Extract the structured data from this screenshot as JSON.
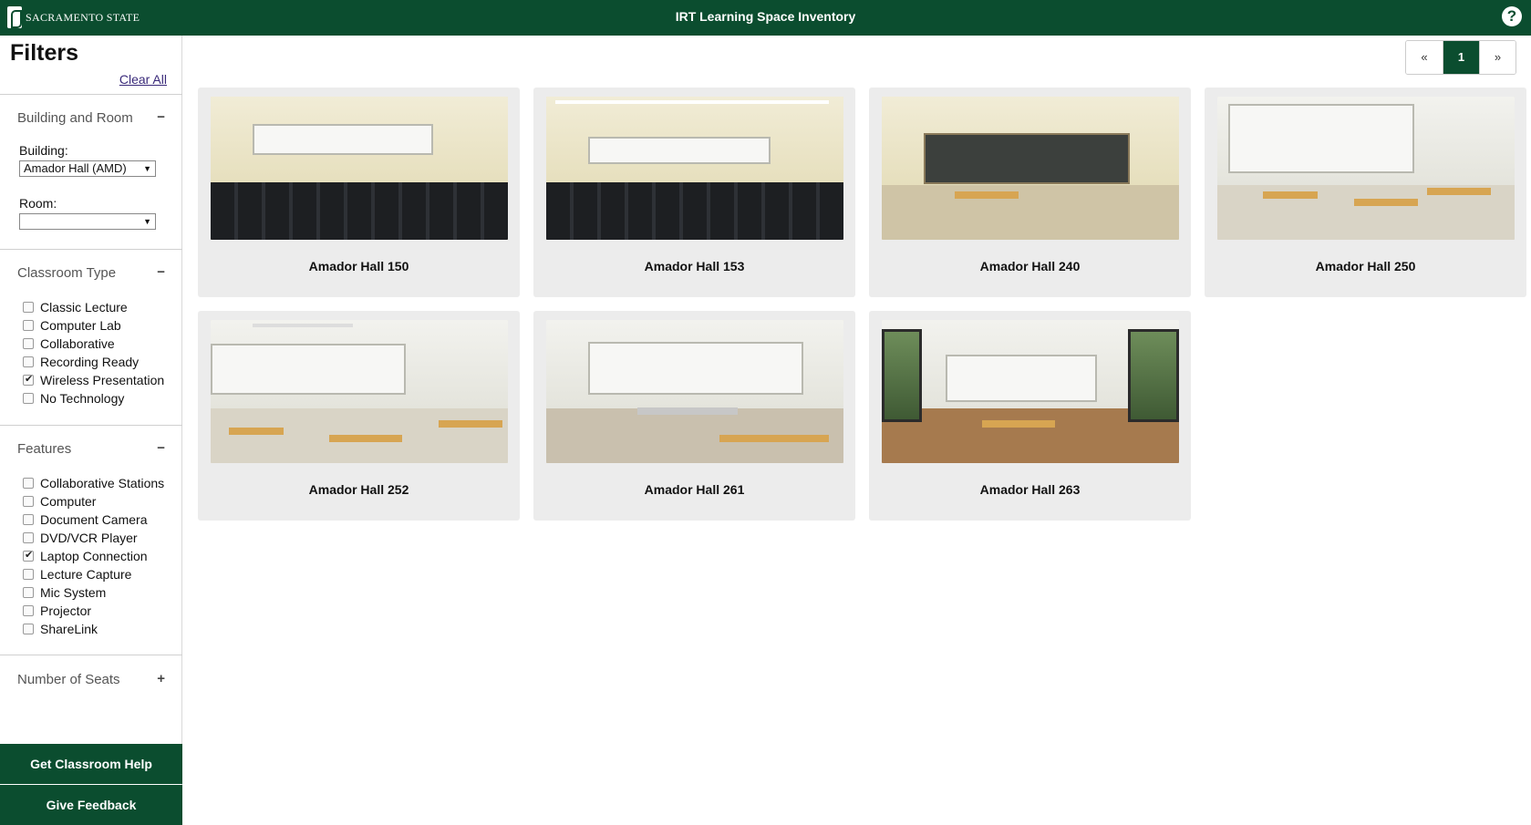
{
  "header": {
    "logo_text": "SACRAMENTO STATE",
    "title": "IRT Learning Space Inventory",
    "help_label": "?"
  },
  "sidebar": {
    "title": "Filters",
    "clear_all": "Clear All",
    "building_room": {
      "heading": "Building and Room",
      "toggle": "−",
      "building_label": "Building:",
      "building_value": "Amador Hall (AMD)",
      "room_label": "Room:",
      "room_value": ""
    },
    "classroom_type": {
      "heading": "Classroom Type",
      "toggle": "−",
      "items": [
        {
          "label": "Classic Lecture",
          "checked": false
        },
        {
          "label": "Computer Lab",
          "checked": false
        },
        {
          "label": "Collaborative",
          "checked": false
        },
        {
          "label": "Recording Ready",
          "checked": false
        },
        {
          "label": "Wireless Presentation",
          "checked": true
        },
        {
          "label": "No Technology",
          "checked": false
        }
      ]
    },
    "features": {
      "heading": "Features",
      "toggle": "−",
      "items": [
        {
          "label": "Collaborative Stations",
          "checked": false
        },
        {
          "label": "Computer",
          "checked": false
        },
        {
          "label": "Document Camera",
          "checked": false
        },
        {
          "label": "DVD/VCR Player",
          "checked": false
        },
        {
          "label": "Laptop Connection",
          "checked": true
        },
        {
          "label": "Lecture Capture",
          "checked": false
        },
        {
          "label": "Mic System",
          "checked": false
        },
        {
          "label": "Projector",
          "checked": false
        },
        {
          "label": "ShareLink",
          "checked": false
        }
      ]
    },
    "seats": {
      "heading": "Number of Seats",
      "toggle": "+"
    },
    "help_button": "Get Classroom Help",
    "feedback_button": "Give Feedback"
  },
  "pagination": {
    "prev": "«",
    "current": "1",
    "next": "»"
  },
  "rooms": [
    {
      "name": "Amador Hall 150",
      "style": "lecture"
    },
    {
      "name": "Amador Hall 153",
      "style": "lecture"
    },
    {
      "name": "Amador Hall 240",
      "style": "chalk"
    },
    {
      "name": "Amador Hall 250",
      "style": "desks"
    },
    {
      "name": "Amador Hall 252",
      "style": "desks"
    },
    {
      "name": "Amador Hall 261",
      "style": "lab"
    },
    {
      "name": "Amador Hall 263",
      "style": "window"
    }
  ],
  "colors": {
    "brand_green": "#0b4d2f",
    "card_bg": "#ececec"
  }
}
